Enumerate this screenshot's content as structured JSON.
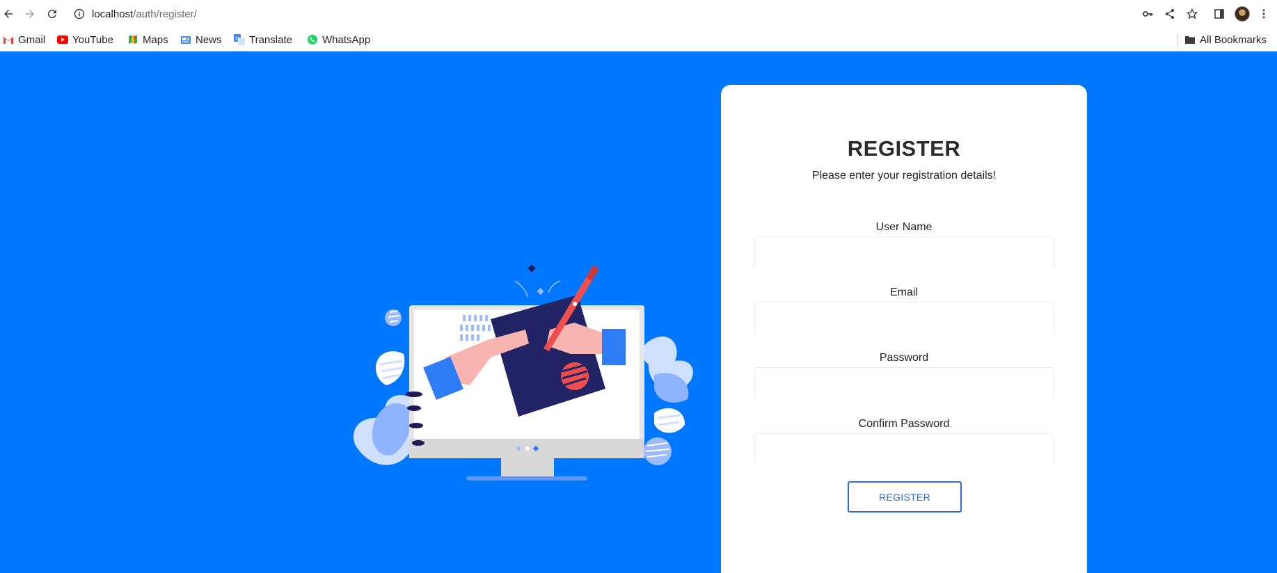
{
  "browser": {
    "url_host": "localhost",
    "url_path": "/auth/register/",
    "bookmarks": [
      {
        "label": "Gmail",
        "icon": "gmail-icon"
      },
      {
        "label": "YouTube",
        "icon": "youtube-icon"
      },
      {
        "label": "Maps",
        "icon": "maps-icon"
      },
      {
        "label": "News",
        "icon": "news-icon"
      },
      {
        "label": "Translate",
        "icon": "translate-icon"
      },
      {
        "label": "WhatsApp",
        "icon": "whatsapp-icon"
      }
    ],
    "all_bookmarks_label": "All Bookmarks"
  },
  "page": {
    "background_color": "#0077ff"
  },
  "form": {
    "title": "REGISTER",
    "subtitle": "Please enter your registration details!",
    "fields": [
      {
        "label": "User Name",
        "value": "",
        "placeholder": ""
      },
      {
        "label": "Email",
        "value": "",
        "placeholder": ""
      },
      {
        "label": "Password",
        "value": "",
        "placeholder": ""
      },
      {
        "label": "Confirm Password",
        "value": "",
        "placeholder": ""
      }
    ],
    "submit_label": "REGISTER",
    "accent_color": "#2e6bd6"
  }
}
